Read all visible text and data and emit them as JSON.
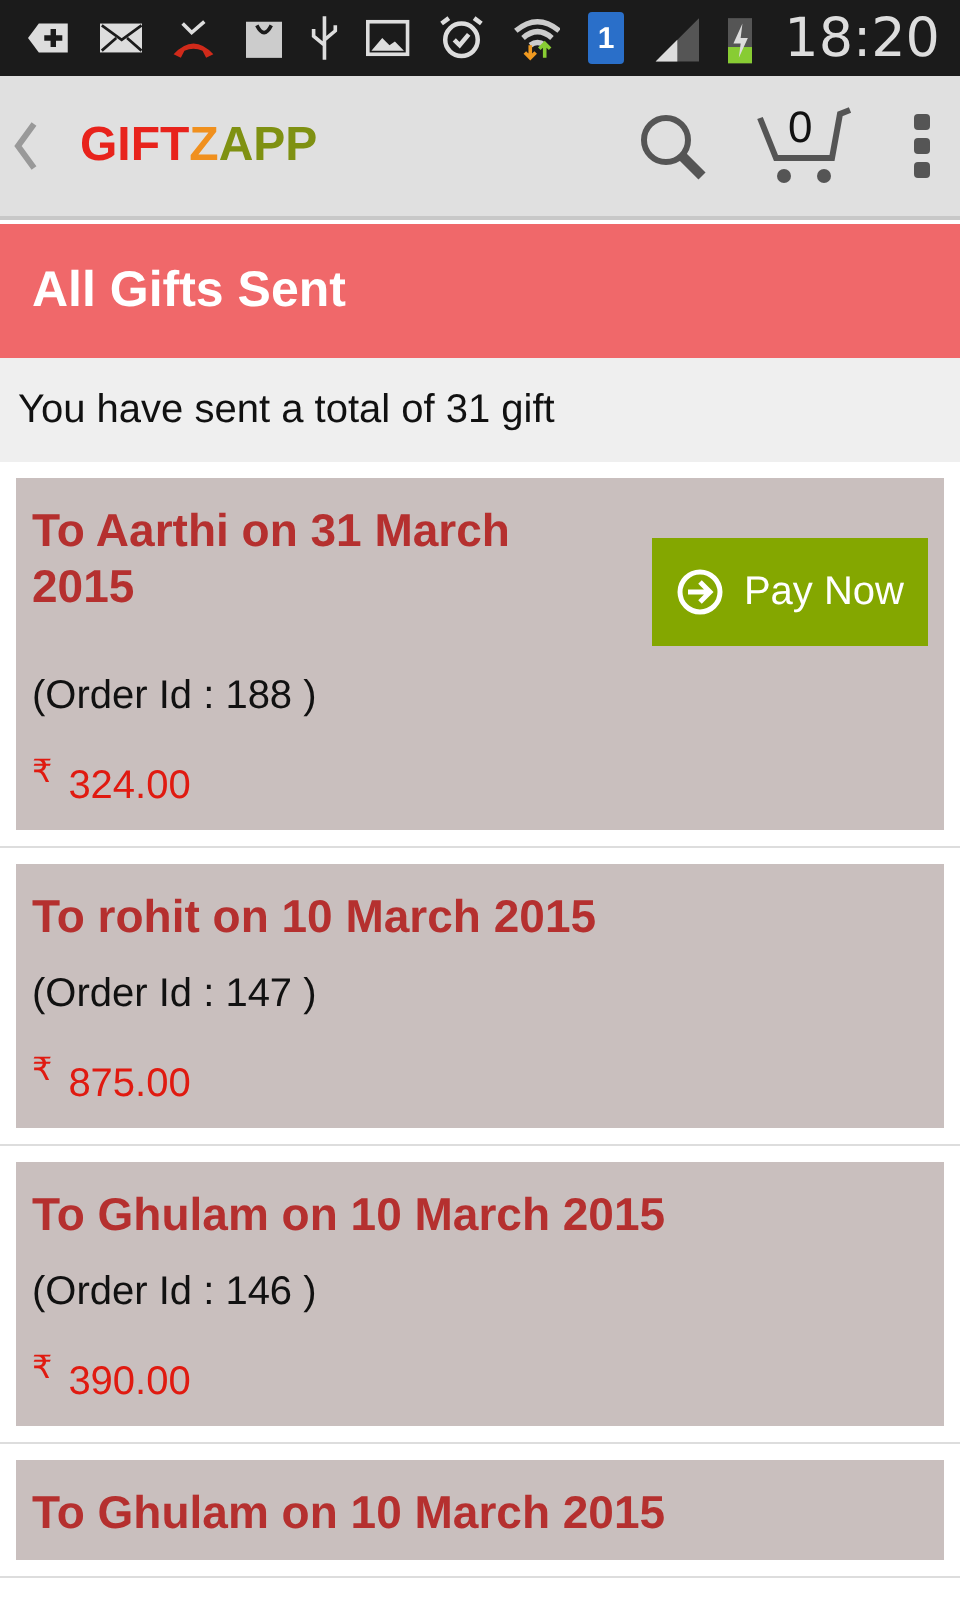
{
  "status_bar": {
    "sim_badge": "1",
    "time": "18:20"
  },
  "app_bar": {
    "logo": [
      {
        "text": "GIFT",
        "color": "#e8231c"
      },
      {
        "text": "Z",
        "color": "#f0901e"
      },
      {
        "text": "APP",
        "color": "#7f9112"
      }
    ],
    "cart_count": "0"
  },
  "header": {
    "title": "All Gifts Sent"
  },
  "summary": "You have sent a total of 31 gift",
  "gifts": [
    {
      "title": "To Aarthi on 31 March 2015",
      "order": "(Order Id : 188 )",
      "currency": "₹",
      "amount": "324.00",
      "pay_button": {
        "label": "Pay Now"
      }
    },
    {
      "title": "To rohit on 10 March 2015",
      "order": "(Order Id : 147 )",
      "currency": "₹",
      "amount": "875.00"
    },
    {
      "title": "To Ghulam on 10 March 2015",
      "order": "(Order Id : 146 )",
      "currency": "₹",
      "amount": "390.00"
    },
    {
      "title": "To Ghulam on 10 March 2015"
    }
  ]
}
